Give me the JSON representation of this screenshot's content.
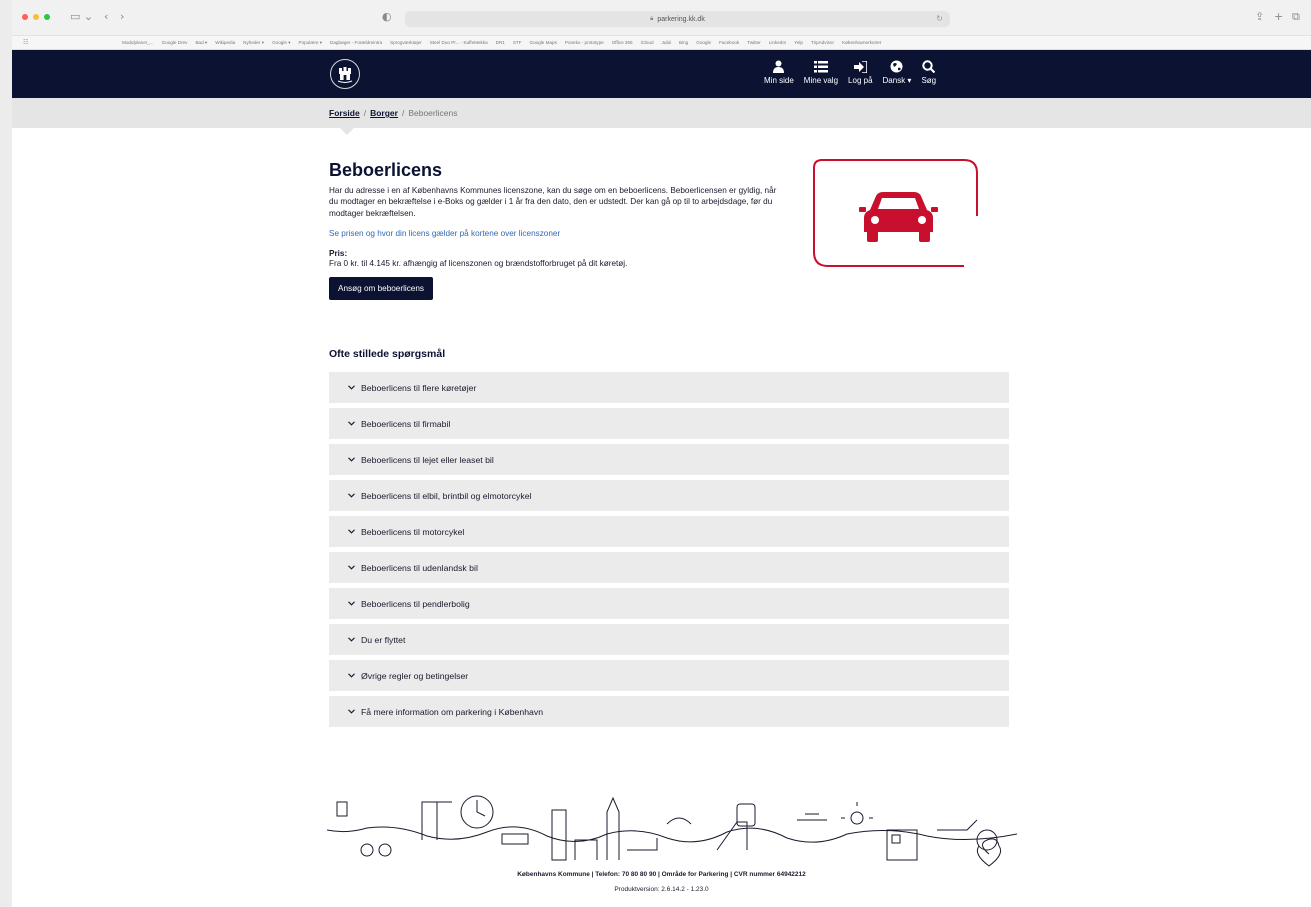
{
  "browser": {
    "url": "parkering.kk.dk",
    "bookmarks": [
      "Modulplaner_...",
      "Google Drev",
      "Bad ▾",
      "Wikipedia",
      "Nyheder ▾",
      "Google ▾",
      "Populære ▾",
      "Dagbøger - Forældreintra",
      "Sprogværktøjer",
      "Steel Duo Pr... - KaffeMekka",
      "DR1",
      "STF",
      "Google Maps",
      "Poneko - prototype",
      "Office 365",
      "iCloud",
      "Jubii",
      "Bing",
      "Google",
      "Facebook",
      "Twitter",
      "LinkedIn",
      "Yelp",
      "TripAdvisor",
      "Københavnerkortet"
    ]
  },
  "header": {
    "nav": [
      {
        "label": "Min side",
        "icon": "user-icon"
      },
      {
        "label": "Mine valg",
        "icon": "list-icon"
      },
      {
        "label": "Log på",
        "icon": "login-icon"
      },
      {
        "label": "Dansk ▾",
        "icon": "globe-icon"
      },
      {
        "label": "Søg",
        "icon": "search-icon"
      }
    ]
  },
  "breadcrumb": {
    "items": [
      "Forside",
      "Borger"
    ],
    "separator": "/",
    "current": "Beboerlicens"
  },
  "main": {
    "title": "Beboerlicens",
    "intro": "Har du adresse i en af Københavns Kommunes licenszone, kan du søge om en beboerlicens. Beboerlicensen er gyldig, når du modtager en bekræftelse i e-Boks og gælder i 1 år fra den dato, den er udstedt. Der kan gå op til to arbejdsdage, før du modtager bekræftelsen.",
    "price_link": "Se prisen og hvor din licens gælder på kortene over licenszoner",
    "price_label": "Pris:",
    "price_text": "Fra 0 kr. til 4.145 kr. afhængig af licenszonen og brændstofforbruget på dit køretøj.",
    "apply_button": "Ansøg om beboerlicens"
  },
  "faq": {
    "title": "Ofte stillede spørgsmål",
    "items": [
      "Beboerlicens til flere køretøjer",
      "Beboerlicens til firmabil",
      "Beboerlicens til lejet eller leaset bil",
      "Beboerlicens til elbil, brintbil og elmotorcykel",
      "Beboerlicens til motorcykel",
      "Beboerlicens til udenlandsk bil",
      "Beboerlicens til pendlerbolig",
      "Du er flyttet",
      "Øvrige regler og betingelser",
      "Få mere information om parkering i København"
    ]
  },
  "footer": {
    "contact": "Københavns Kommune | Telefon: 70 80 80 90 | Område for Parkering | CVR nummer 64942212",
    "version": "Produktversion: 2.6.14.2 - 1.23.0"
  },
  "colors": {
    "header_bg": "#0b1232",
    "accent_red": "#c8102e",
    "link_blue": "#2f6ab5",
    "faq_bg": "#ebebeb"
  }
}
